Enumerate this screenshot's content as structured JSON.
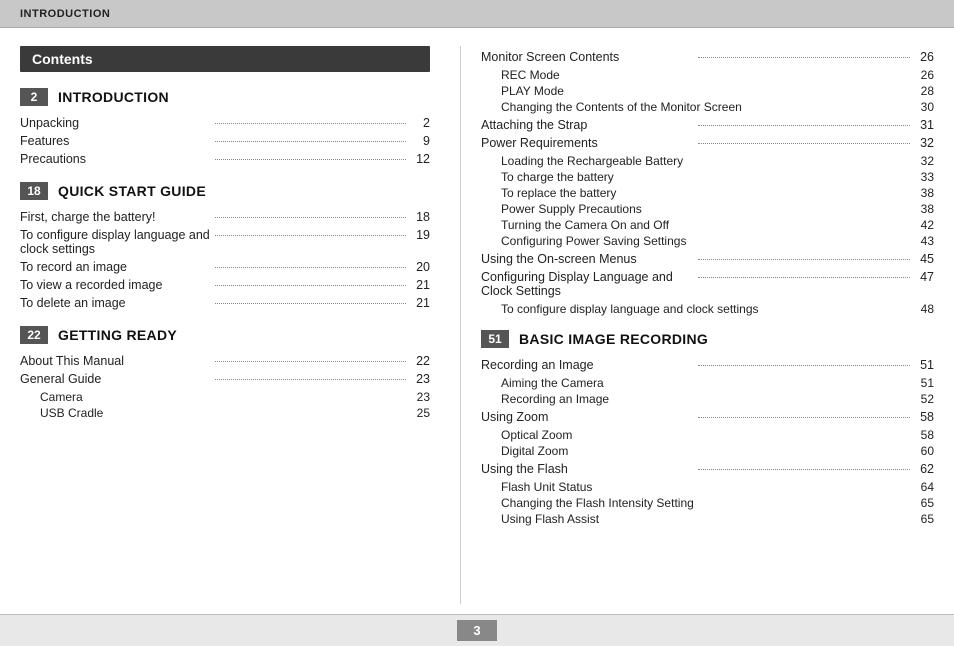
{
  "topbar": {
    "label": "INTRODUCTION"
  },
  "left": {
    "contents_label": "Contents",
    "sections": [
      {
        "num": "2",
        "title": "INTRODUCTION",
        "entries": [
          {
            "label": "Unpacking",
            "page": "2",
            "has_dots": true
          },
          {
            "label": "Features",
            "page": "9",
            "has_dots": true
          },
          {
            "label": "Precautions",
            "page": "12",
            "has_dots": true
          }
        ]
      },
      {
        "num": "18",
        "title": "QUICK START GUIDE",
        "entries": [
          {
            "label": "First, charge the battery!",
            "page": "18",
            "has_dots": true
          },
          {
            "label": "To configure display language and clock settings",
            "page": "19",
            "has_dots": true
          },
          {
            "label": "To record an image",
            "page": "20",
            "has_dots": true
          },
          {
            "label": "To view a recorded image",
            "page": "21",
            "has_dots": true
          },
          {
            "label": "To delete an image",
            "page": "21",
            "has_dots": true
          }
        ]
      },
      {
        "num": "22",
        "title": "GETTING READY",
        "entries": [
          {
            "label": "About This Manual",
            "page": "22",
            "has_dots": true
          },
          {
            "label": "General Guide",
            "page": "23",
            "has_dots": true
          }
        ],
        "sub_entries": [
          {
            "label": "Camera",
            "page": "23"
          },
          {
            "label": "USB Cradle",
            "page": "25"
          }
        ]
      }
    ]
  },
  "right": {
    "entries": [
      {
        "type": "main",
        "label": "Monitor Screen Contents",
        "page": "26",
        "has_dots": true
      },
      {
        "type": "sub",
        "label": "REC Mode",
        "page": "26"
      },
      {
        "type": "sub",
        "label": "PLAY Mode",
        "page": "28"
      },
      {
        "type": "sub",
        "label": "Changing the Contents of the Monitor Screen",
        "page": "30"
      },
      {
        "type": "main",
        "label": "Attaching the Strap",
        "page": "31",
        "has_dots": true
      },
      {
        "type": "main",
        "label": "Power Requirements",
        "page": "32",
        "has_dots": true
      },
      {
        "type": "sub",
        "label": "Loading the Rechargeable Battery",
        "page": "32"
      },
      {
        "type": "sub",
        "label": "To charge the battery",
        "page": "33"
      },
      {
        "type": "sub",
        "label": "To replace the battery",
        "page": "38"
      },
      {
        "type": "sub",
        "label": "Power Supply Precautions",
        "page": "38"
      },
      {
        "type": "sub",
        "label": "Turning the Camera On and Off",
        "page": "42"
      },
      {
        "type": "sub",
        "label": "Configuring Power Saving Settings",
        "page": "43"
      },
      {
        "type": "main",
        "label": "Using the On-screen Menus",
        "page": "45",
        "has_dots": true
      },
      {
        "type": "main",
        "label": "Configuring Display Language and Clock Settings",
        "page": "47",
        "has_dots": true
      },
      {
        "type": "sub",
        "label": "To configure display language and clock settings",
        "page": "48"
      }
    ],
    "section": {
      "num": "51",
      "title": "BASIC IMAGE RECORDING",
      "entries": [
        {
          "type": "main",
          "label": "Recording an Image",
          "page": "51",
          "has_dots": true
        },
        {
          "type": "sub",
          "label": "Aiming the Camera",
          "page": "51"
        },
        {
          "type": "sub",
          "label": "Recording an Image",
          "page": "52"
        },
        {
          "type": "main",
          "label": "Using Zoom",
          "page": "58",
          "has_dots": true
        },
        {
          "type": "sub",
          "label": "Optical Zoom",
          "page": "58"
        },
        {
          "type": "sub",
          "label": "Digital Zoom",
          "page": "60"
        },
        {
          "type": "main",
          "label": "Using the Flash",
          "page": "62",
          "has_dots": true
        },
        {
          "type": "sub",
          "label": "Flash Unit Status",
          "page": "64"
        },
        {
          "type": "sub",
          "label": "Changing the Flash Intensity Setting",
          "page": "65"
        },
        {
          "type": "sub",
          "label": "Using Flash Assist",
          "page": "65"
        }
      ]
    }
  },
  "bottom": {
    "page_number": "3"
  }
}
